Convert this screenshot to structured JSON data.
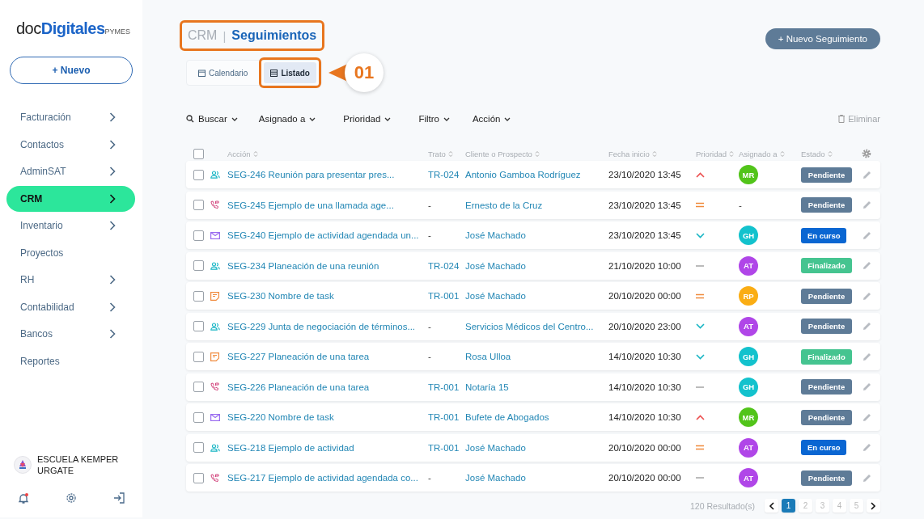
{
  "sidebar": {
    "logo": {
      "prefix": "doc",
      "brand": "Digitales",
      "suffix": "PYMES"
    },
    "new_button": "+ Nuevo",
    "items": [
      {
        "label": "Facturación",
        "expandable": true,
        "selected": false
      },
      {
        "label": "Contactos",
        "expandable": true,
        "selected": false
      },
      {
        "label": "AdminSAT",
        "expandable": true,
        "selected": false
      },
      {
        "label": "CRM",
        "expandable": true,
        "selected": true
      },
      {
        "label": "Inventario",
        "expandable": true,
        "selected": false
      },
      {
        "label": "Proyectos",
        "expandable": false,
        "selected": false
      },
      {
        "label": "RH",
        "expandable": true,
        "selected": false
      },
      {
        "label": "Contabilidad",
        "expandable": true,
        "selected": false
      },
      {
        "label": "Bancos",
        "expandable": true,
        "selected": false
      },
      {
        "label": "Reportes",
        "expandable": false,
        "selected": false
      }
    ],
    "account": {
      "name": "ESCUELA KEMPER URGATE"
    },
    "notifications_unread": true
  },
  "header": {
    "section": "CRM",
    "separator": "|",
    "title": "Seguimientos",
    "highlighted": true,
    "new_button": "+ Nuevo Seguimiento"
  },
  "view_tabs": [
    {
      "label": "Calendario",
      "kind": "calendar",
      "selected": false,
      "highlighted": false
    },
    {
      "label": "Listado",
      "kind": "list",
      "selected": true,
      "highlighted": true
    }
  ],
  "callout": {
    "label": "01"
  },
  "toolbar": {
    "filters": [
      "Buscar",
      "Asignado a",
      "Prioridad",
      "Filtro",
      "Acción"
    ],
    "delete": "Eliminar"
  },
  "table": {
    "all_selected": false,
    "columns": [
      "Acción",
      "Trato",
      "Cliente o Prospecto",
      "Fecha inicio",
      "Prioridad",
      "Asignado a",
      "Estado"
    ],
    "rows": [
      {
        "kind": "meeting",
        "action": "SEG-246 Reunión para presentar pres...",
        "deal": "TR-024",
        "client": "Antonio Gamboa Rodríguez",
        "date": "23/10/2020 13:45",
        "priority": {
          "kind": "high"
        },
        "assignee": {
          "initials": "MR",
          "color": "#52c41a"
        },
        "status": {
          "label": "Pendiente",
          "kind": "pending"
        },
        "checked": false
      },
      {
        "kind": "call",
        "action": "SEG-245 Ejemplo de una llamada age...",
        "deal": "-",
        "client": "Ernesto de la Cruz",
        "date": "23/10/2020 13:45",
        "priority": {
          "kind": "medium"
        },
        "assignee": {
          "initials": "-"
        },
        "status": {
          "label": "Pendiente",
          "kind": "pending"
        },
        "checked": false
      },
      {
        "kind": "email",
        "action": "SEG-240 Ejemplo de actividad agendada un...",
        "deal": "-",
        "client": "José Machado",
        "date": "23/10/2020 13:45",
        "priority": {
          "kind": "low"
        },
        "assignee": {
          "initials": "GH",
          "color": "#13c2cd"
        },
        "status": {
          "label": "En curso",
          "kind": "in_progress"
        },
        "checked": false
      },
      {
        "kind": "meeting",
        "action": "SEG-234 Planeación de una reunión",
        "deal": "TR-024",
        "client": "José Machado",
        "date": "21/10/2020 10:00",
        "priority": {
          "kind": "none"
        },
        "assignee": {
          "initials": "AT",
          "color": "#b046e8"
        },
        "status": {
          "label": "Finalizado",
          "kind": "done"
        },
        "checked": false
      },
      {
        "kind": "task",
        "action": "SEG-230 Nombre de task",
        "deal": "TR-001",
        "client": "José Machado",
        "date": "20/10/2020 00:00",
        "priority": {
          "kind": "medium"
        },
        "assignee": {
          "initials": "RP",
          "color": "#faad14"
        },
        "status": {
          "label": "Pendiente",
          "kind": "pending"
        },
        "checked": false
      },
      {
        "kind": "meeting",
        "action": "SEG-229 Junta de negociación de términos...",
        "deal": "-",
        "client": "Servicios Médicos del Centro...",
        "date": "20/10/2020 23:00",
        "priority": {
          "kind": "low"
        },
        "assignee": {
          "initials": "AT",
          "color": "#b046e8"
        },
        "status": {
          "label": "Pendiente",
          "kind": "pending"
        },
        "checked": false
      },
      {
        "kind": "task",
        "action": "SEG-227 Planeación de una tarea",
        "deal": "-",
        "client": "Rosa Ulloa",
        "date": "14/10/2020 10:30",
        "priority": {
          "kind": "low"
        },
        "assignee": {
          "initials": "GH",
          "color": "#13c2cd"
        },
        "status": {
          "label": "Finalizado",
          "kind": "done"
        },
        "checked": false
      },
      {
        "kind": "call",
        "action": "SEG-226 Planeación de una tarea",
        "deal": "TR-001",
        "client": "Notaría 15",
        "date": "14/10/2020 10:30",
        "priority": {
          "kind": "none"
        },
        "assignee": {
          "initials": "GH",
          "color": "#13c2cd"
        },
        "status": {
          "label": "Pendiente",
          "kind": "pending"
        },
        "checked": false
      },
      {
        "kind": "email",
        "action": "SEG-220 Nombre de task",
        "deal": "TR-001",
        "client": "Bufete de Abogados",
        "date": "14/10/2020 10:30",
        "priority": {
          "kind": "high"
        },
        "assignee": {
          "initials": "MR",
          "color": "#52c41a"
        },
        "status": {
          "label": "Pendiente",
          "kind": "pending"
        },
        "checked": false
      },
      {
        "kind": "meeting",
        "action": "SEG-218 Ejemplo de actividad",
        "deal": "TR-001",
        "client": "José Machado",
        "date": "20/10/2020 00:00",
        "priority": {
          "kind": "medium"
        },
        "assignee": {
          "initials": "AT",
          "color": "#b046e8"
        },
        "status": {
          "label": "En curso",
          "kind": "in_progress"
        },
        "checked": false
      },
      {
        "kind": "call",
        "action": "SEG-217 Ejemplo de actividad agendada co...",
        "deal": "-",
        "client": "José Machado",
        "date": "20/10/2020 00:00",
        "priority": {
          "kind": "none"
        },
        "assignee": {
          "initials": "AT",
          "color": "#b046e8"
        },
        "status": {
          "label": "Pendiente",
          "kind": "pending"
        },
        "checked": false
      }
    ]
  },
  "pagination": {
    "results": "120 Resultado(s)",
    "pages": [
      {
        "label": "1",
        "selected": true
      },
      {
        "label": "2",
        "selected": false
      },
      {
        "label": "3",
        "selected": false
      },
      {
        "label": "4",
        "selected": false
      },
      {
        "label": "5",
        "selected": false
      }
    ]
  }
}
